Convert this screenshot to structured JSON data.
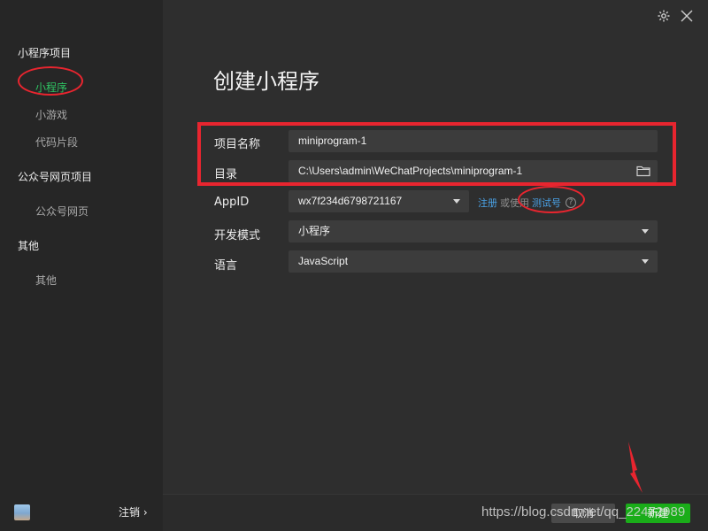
{
  "sidebar": {
    "groups": [
      {
        "label": "小程序项目",
        "items": [
          {
            "label": "小程序"
          },
          {
            "label": "小游戏"
          },
          {
            "label": "代码片段"
          }
        ]
      },
      {
        "label": "公众号网页项目",
        "items": [
          {
            "label": "公众号网页"
          }
        ]
      },
      {
        "label": "其他",
        "items": [
          {
            "label": "其他"
          }
        ]
      }
    ],
    "active_item": "小程序",
    "logout_label": "注销 ›"
  },
  "header": {
    "settings_icon": "gear-icon",
    "close_icon": "close-icon"
  },
  "main": {
    "title": "创建小程序",
    "fields": {
      "project_name": {
        "label": "项目名称",
        "value": "miniprogram-1"
      },
      "directory": {
        "label": "目录",
        "value": "C:\\Users\\admin\\WeChatProjects\\miniprogram-1"
      },
      "appid": {
        "label": "AppID",
        "value": "wx7f234d6798721167"
      },
      "dev_mode": {
        "label": "开发模式",
        "value": "小程序"
      },
      "language": {
        "label": "语言",
        "value": "JavaScript"
      }
    },
    "appid_links": {
      "register": "注册",
      "or_use": "或使用",
      "test_id": "测试号",
      "help": "?"
    }
  },
  "footer": {
    "cancel_label": "取消",
    "create_label": "新建"
  },
  "watermark": "https://blog.csdn.net/qq_22472989",
  "colors": {
    "accent": "#1aad19",
    "active_text": "#2fc463",
    "link": "#4aa3e8",
    "annotation": "#e8252f"
  }
}
